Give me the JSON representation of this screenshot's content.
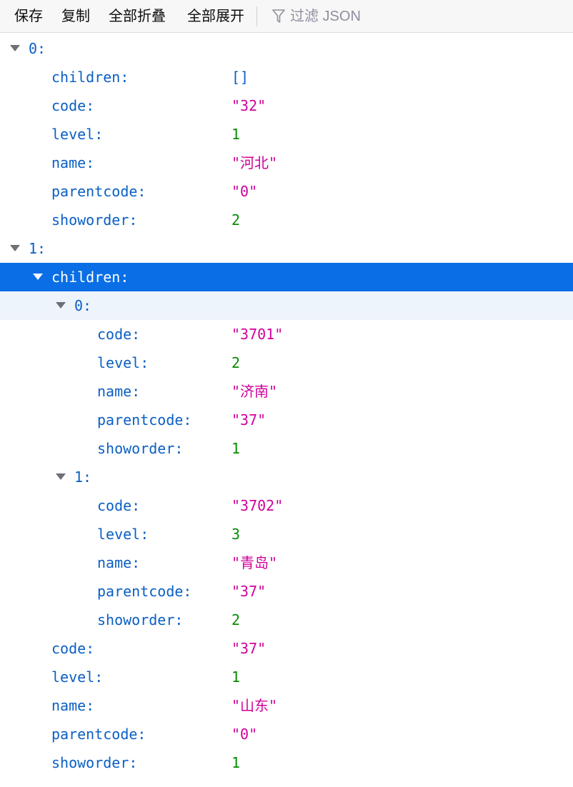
{
  "toolbar": {
    "save": "保存",
    "copy": "复制",
    "collapse_all": "全部折叠",
    "expand_all": "全部展开",
    "filter_placeholder": "过滤 JSON"
  },
  "tree": {
    "item0": {
      "index": "0:",
      "children_key": "children:",
      "children_val": "[]",
      "code_key": "code:",
      "code_val": "\"32\"",
      "level_key": "level:",
      "level_val": "1",
      "name_key": "name:",
      "name_val": "\"河北\"",
      "parentcode_key": "parentcode:",
      "parentcode_val": "\"0\"",
      "showorder_key": "showorder:",
      "showorder_val": "2"
    },
    "item1": {
      "index": "1:",
      "children_key": "children:",
      "children": [
        {
          "index": "0:",
          "code_key": "code:",
          "code_val": "\"3701\"",
          "level_key": "level:",
          "level_val": "2",
          "name_key": "name:",
          "name_val": "\"济南\"",
          "parentcode_key": "parentcode:",
          "parentcode_val": "\"37\"",
          "showorder_key": "showorder:",
          "showorder_val": "1"
        },
        {
          "index": "1:",
          "code_key": "code:",
          "code_val": "\"3702\"",
          "level_key": "level:",
          "level_val": "3",
          "name_key": "name:",
          "name_val": "\"青岛\"",
          "parentcode_key": "parentcode:",
          "parentcode_val": "\"37\"",
          "showorder_key": "showorder:",
          "showorder_val": "2"
        }
      ],
      "code_key": "code:",
      "code_val": "\"37\"",
      "level_key": "level:",
      "level_val": "1",
      "name_key": "name:",
      "name_val": "\"山东\"",
      "parentcode_key": "parentcode:",
      "parentcode_val": "\"0\"",
      "showorder_key": "showorder:",
      "showorder_val": "1"
    }
  },
  "colors": {
    "key": "#0a5fc4",
    "string": "#d0009a",
    "number": "#058b00",
    "selection": "#0a6fe6"
  },
  "icons": {
    "filter": "filter-funnel-icon",
    "toggle": "disclosure-triangle-icon"
  }
}
